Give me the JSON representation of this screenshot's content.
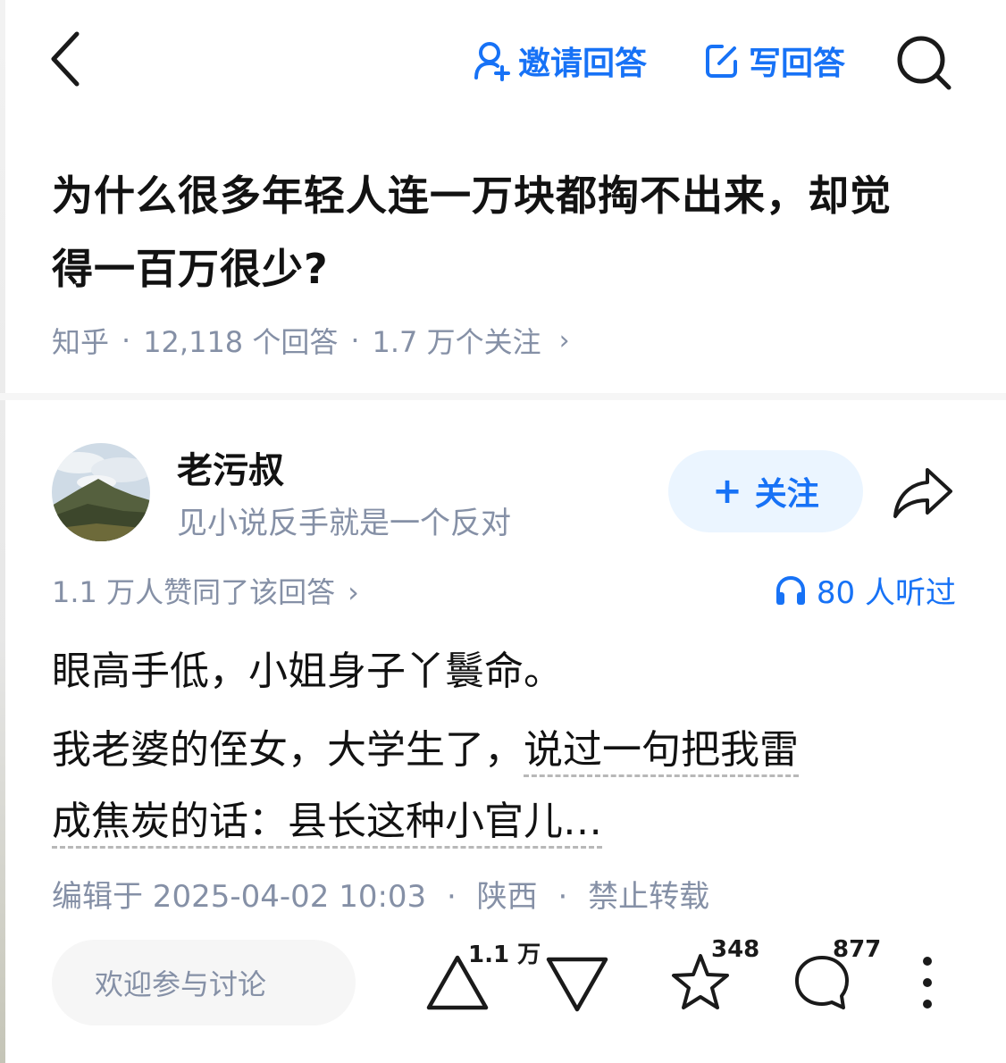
{
  "topbar": {
    "back_icon": "chevron-left-icon",
    "invite_label": "邀请回答",
    "invite_icon": "add-user-icon",
    "write_label": "写回答",
    "write_icon": "edit-icon",
    "search_icon": "search-icon"
  },
  "question": {
    "title": "为什么很多年轻人连一万块都掏不出来，却觉得一百万很少?",
    "source": "知乎",
    "answers_count": "12,118 个回答",
    "followers": "1.7 万个关注",
    "chevron": "›"
  },
  "author": {
    "name": "老污叔",
    "bio": "见小说反手就是一个反对",
    "follow_plus": "+",
    "follow_label": "关注",
    "share_icon": "share-icon"
  },
  "stats": {
    "vote_summary": "1.1 万人赞同了该回答",
    "chevron": "›",
    "listen_label": "80 人听过",
    "listen_icon": "headphones-icon"
  },
  "answer": {
    "p1": "眼高手低，小姐身子丫鬟命。",
    "p2_plain": "我老婆的侄女，大学生了，说过一句把我雷",
    "p2_dotted_a": "说过一句把我雷",
    "p2_line2": "成焦炭的话：县长这种小官儿…",
    "edited": "编辑于 2025-04-02 10:03",
    "location": "陕西",
    "copyright": "禁止转载",
    "sep": "·"
  },
  "actions": {
    "comment_placeholder": "欢迎参与讨论",
    "upvote_count": "1.1 万",
    "favorite_count": "348",
    "comment_count": "877",
    "accent_color": "#1772f6",
    "text_gray": "#8590a6"
  }
}
